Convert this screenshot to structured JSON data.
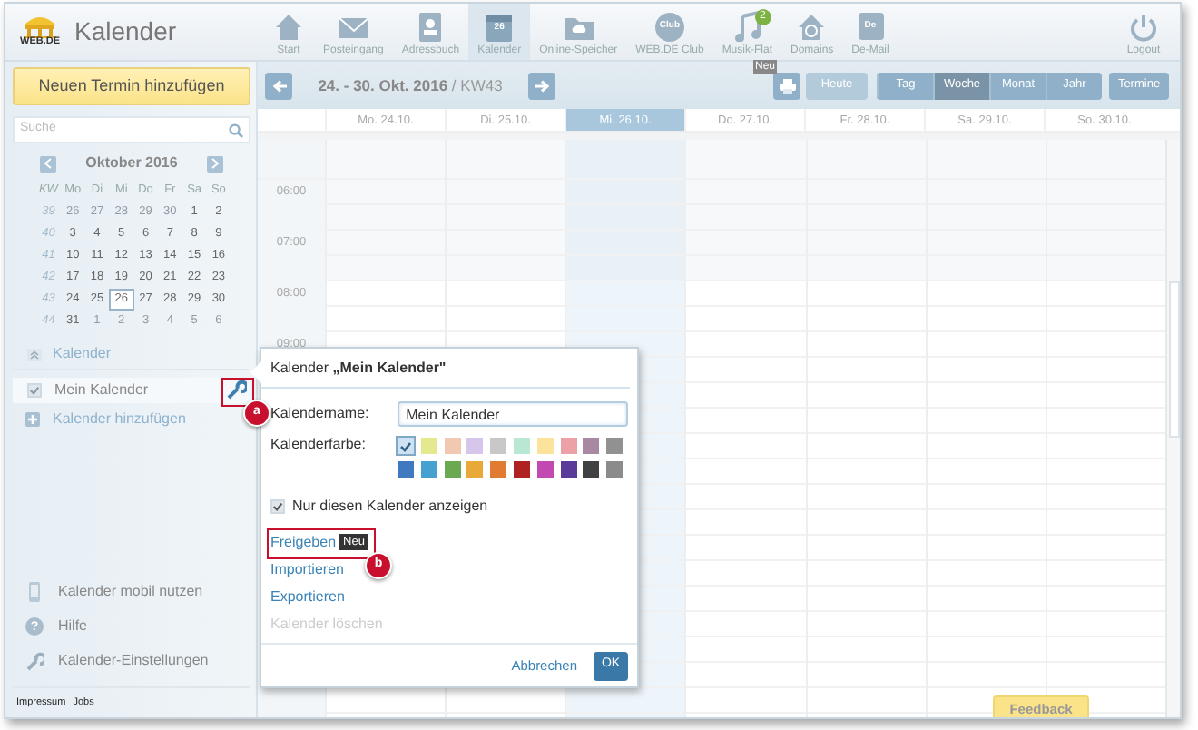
{
  "header": {
    "logo_text": "WEB.DE",
    "title": "Kalender",
    "nav": [
      {
        "label": "Start",
        "selected": false
      },
      {
        "label": "Posteingang",
        "selected": false
      },
      {
        "label": "Adressbuch",
        "selected": false
      },
      {
        "label": "Kalender",
        "icon_text": "26",
        "selected": true
      },
      {
        "label": "Online-Speicher",
        "selected": false
      },
      {
        "label": "WEB.DE Club",
        "icon_text": "Club",
        "selected": false
      },
      {
        "label": "Musik-Flat",
        "badge": "2",
        "selected": false
      },
      {
        "label": "Domains",
        "selected": false
      },
      {
        "label": "De-Mail",
        "icon_text": "De",
        "selected": false
      }
    ],
    "logout": "Logout"
  },
  "sidebar": {
    "new_button": "Neuen Termin hinzufügen",
    "search": {
      "placeholder": "Suche"
    },
    "mini_calendar": {
      "month": "Oktober 2016",
      "headers": [
        "KW",
        "Mo",
        "Di",
        "Mi",
        "Do",
        "Fr",
        "Sa",
        "So"
      ],
      "weeks": [
        {
          "kw": "39",
          "days": [
            {
              "d": "26",
              "other": true,
              "today": false
            },
            {
              "d": "27",
              "other": true,
              "today": false
            },
            {
              "d": "28",
              "other": true,
              "today": false
            },
            {
              "d": "29",
              "other": true,
              "today": false
            },
            {
              "d": "30",
              "other": true,
              "today": false
            },
            {
              "d": "1",
              "other": false,
              "today": false
            },
            {
              "d": "2",
              "other": false,
              "today": false
            }
          ]
        },
        {
          "kw": "40",
          "days": [
            {
              "d": "3",
              "other": false,
              "today": false
            },
            {
              "d": "4",
              "other": false,
              "today": false
            },
            {
              "d": "5",
              "other": false,
              "today": false
            },
            {
              "d": "6",
              "other": false,
              "today": false
            },
            {
              "d": "7",
              "other": false,
              "today": false
            },
            {
              "d": "8",
              "other": false,
              "today": false
            },
            {
              "d": "9",
              "other": false,
              "today": false
            }
          ]
        },
        {
          "kw": "41",
          "days": [
            {
              "d": "10",
              "other": false,
              "today": false
            },
            {
              "d": "11",
              "other": false,
              "today": false
            },
            {
              "d": "12",
              "other": false,
              "today": false
            },
            {
              "d": "13",
              "other": false,
              "today": false
            },
            {
              "d": "14",
              "other": false,
              "today": false
            },
            {
              "d": "15",
              "other": false,
              "today": false
            },
            {
              "d": "16",
              "other": false,
              "today": false
            }
          ]
        },
        {
          "kw": "42",
          "days": [
            {
              "d": "17",
              "other": false,
              "today": false
            },
            {
              "d": "18",
              "other": false,
              "today": false
            },
            {
              "d": "19",
              "other": false,
              "today": false
            },
            {
              "d": "20",
              "other": false,
              "today": false
            },
            {
              "d": "21",
              "other": false,
              "today": false
            },
            {
              "d": "22",
              "other": false,
              "today": false
            },
            {
              "d": "23",
              "other": false,
              "today": false
            }
          ]
        },
        {
          "kw": "43",
          "days": [
            {
              "d": "24",
              "other": false,
              "today": false
            },
            {
              "d": "25",
              "other": false,
              "today": false
            },
            {
              "d": "26",
              "other": false,
              "today": true
            },
            {
              "d": "27",
              "other": false,
              "today": false
            },
            {
              "d": "28",
              "other": false,
              "today": false
            },
            {
              "d": "29",
              "other": false,
              "today": false
            },
            {
              "d": "30",
              "other": false,
              "today": false
            }
          ]
        },
        {
          "kw": "44",
          "days": [
            {
              "d": "31",
              "other": false,
              "today": false
            },
            {
              "d": "1",
              "other": true,
              "today": false
            },
            {
              "d": "2",
              "other": true,
              "today": false
            },
            {
              "d": "3",
              "other": true,
              "today": false
            },
            {
              "d": "4",
              "other": true,
              "today": false
            },
            {
              "d": "5",
              "other": true,
              "today": false
            },
            {
              "d": "6",
              "other": true,
              "today": false
            }
          ]
        }
      ]
    },
    "calendars_title": "Kalender",
    "calendars": [
      {
        "name": "Mein Kalender",
        "checked": true
      }
    ],
    "add_calendar": "Kalender hinzufügen",
    "links": [
      {
        "label": "Kalender mobil nutzen"
      },
      {
        "label": "Hilfe",
        "icon_text": "?"
      },
      {
        "label": "Kalender-Einstellungen"
      }
    ],
    "footer": [
      "Impressum",
      "Jobs"
    ]
  },
  "toolbar": {
    "range": "**24. - 30. Okt. 2016** / KW43",
    "print_badge": "Neu",
    "today": {
      "label": "Heute",
      "disabled": true
    },
    "views": [
      {
        "label": "Tag",
        "selected": false
      },
      {
        "label": "Woche",
        "selected": true
      },
      {
        "label": "Monat",
        "selected": false
      },
      {
        "label": "Jahr",
        "selected": false
      }
    ],
    "list": "Termine"
  },
  "days": [
    {
      "label": "Mo. 24.10.",
      "selected": false
    },
    {
      "label": "Di. 25.10.",
      "selected": false
    },
    {
      "label": "Mi. 26.10.",
      "selected": true
    },
    {
      "label": "Do. 27.10.",
      "selected": false
    },
    {
      "label": "Fr. 28.10.",
      "selected": false
    },
    {
      "label": "Sa. 29.10.",
      "selected": false
    },
    {
      "label": "So. 30.10.",
      "selected": false
    }
  ],
  "times": [
    "06:00",
    "07:00",
    "08:00",
    "09:00"
  ],
  "popup": {
    "title": "Kalender **„Mein Kalender\"**",
    "name_label": "Kalendername:",
    "name_value": "Mein Kalender",
    "color_label": "Kalenderfarbe:",
    "colors": [
      {
        "color": "#cfe2f3",
        "selected": true
      },
      {
        "color": "#e4e98f",
        "selected": false
      },
      {
        "color": "#f1c9b1",
        "selected": false
      },
      {
        "color": "#d6c6eb",
        "selected": false
      },
      {
        "color": "#c8c8c8",
        "selected": false
      },
      {
        "color": "#b8e7d3",
        "selected": false
      },
      {
        "color": "#fbe39b",
        "selected": false
      },
      {
        "color": "#eba1a5",
        "selected": false
      },
      {
        "color": "#a889a1",
        "selected": false
      },
      {
        "color": "#919191",
        "selected": false
      },
      {
        "color": "#3f79bf",
        "selected": false
      },
      {
        "color": "#46a1d1",
        "selected": false
      },
      {
        "color": "#6ba950",
        "selected": false
      },
      {
        "color": "#e9a939",
        "selected": false
      },
      {
        "color": "#e07b31",
        "selected": false
      },
      {
        "color": "#b02121",
        "selected": false
      },
      {
        "color": "#c149b1",
        "selected": false
      },
      {
        "color": "#5b3b99",
        "selected": false
      },
      {
        "color": "#414141",
        "selected": false
      },
      {
        "color": "#8b8b8b",
        "selected": false
      }
    ],
    "only_this": {
      "label": "Nur diesen Kalender anzeigen",
      "checked": true
    },
    "actions": [
      {
        "label": "Freigeben",
        "disabled": false,
        "badge": "Neu"
      },
      {
        "label": "Importieren",
        "disabled": false
      },
      {
        "label": "Exportieren",
        "disabled": false
      },
      {
        "label": "Kalender löschen",
        "disabled": true
      }
    ],
    "cancel": "Abbrechen",
    "ok": "OK"
  },
  "annotations": [
    {
      "label": "a"
    },
    {
      "label": "b"
    }
  ],
  "feedback": "Feedback"
}
